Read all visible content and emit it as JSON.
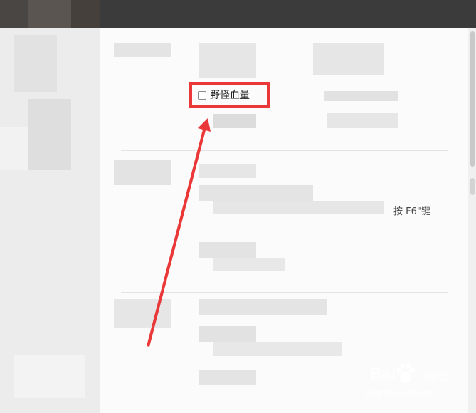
{
  "option": {
    "label": "野怪血量",
    "checked": false
  },
  "hint_fragment": "按 F6\"键",
  "annotation": {
    "highlight_color": "#ea3838",
    "arrow_color": "#ea3838"
  },
  "watermark": {
    "brand": "Bai",
    "brand_cn": "经验",
    "url": "jingyan.baidu.com"
  },
  "colors": {
    "titlebar": "#3b3b3b",
    "panel": "#fbfbfb",
    "sidebar": "#ececec"
  }
}
